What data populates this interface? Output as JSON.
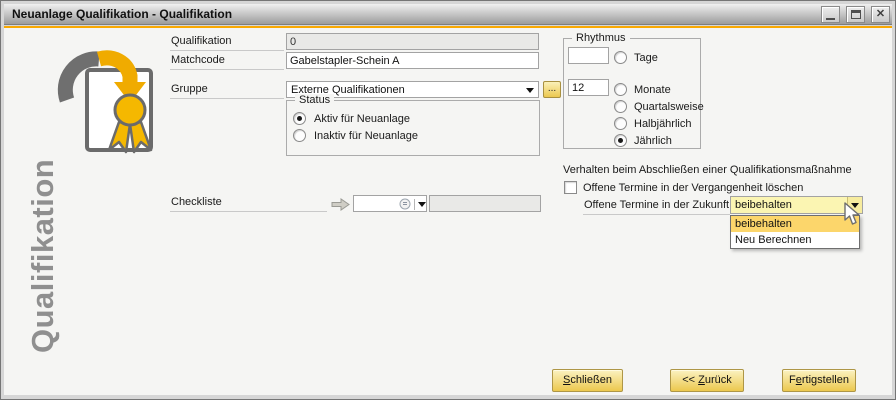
{
  "window": {
    "title": "Neuanlage Qualifikation - Qualifikation"
  },
  "sidebar": {
    "vertical_label": "Qualifikation",
    "icon": "certificate-icon"
  },
  "form": {
    "qualifikation_label": "Qualifikation",
    "qualifikation_value": "0",
    "matchcode_label": "Matchcode",
    "matchcode_value": "Gabelstapler-Schein A",
    "gruppe_label": "Gruppe",
    "gruppe_value": "Externe Qualifikationen",
    "browse_label": "...",
    "status": {
      "title": "Status",
      "aktiv_label": "Aktiv für Neuanlage",
      "inaktiv_label": "Inaktiv für Neuanlage",
      "selected": "Aktiv für Neuanlage"
    },
    "checkliste_label": "Checkliste",
    "checkliste_value": "",
    "checkliste_value2": ""
  },
  "rhythmus": {
    "title": "Rhythmus",
    "tage_value": "",
    "tage_label": "Tage",
    "monate_value": "12",
    "monate_label": "Monate",
    "quartalsweise_label": "Quartalsweise",
    "halbjaehrlich_label": "Halbjährlich",
    "jaehrlich_label": "Jährlich",
    "selected": "Jährlich"
  },
  "verhalten": {
    "heading": "Verhalten beim Abschließen einer Qualifikationsmaßnahme",
    "vergangenheit_label": "Offene Termine in der Vergangenheit löschen",
    "vergangenheit_checked": false,
    "zukunft_label": "Offene Termine in der Zukunft",
    "zukunft_value": "beibehalten",
    "options": [
      "beibehalten",
      "Neu Berechnen"
    ],
    "highlighted_option": "beibehalten"
  },
  "footer": {
    "schliessen": {
      "u": "S",
      "rest": "chließen"
    },
    "zurueck": {
      "pre": "<< ",
      "u": "Z",
      "rest": "urück"
    },
    "fertigstellen": {
      "pre": "F",
      "u": "e",
      "rest": "rtigstellen"
    }
  },
  "colors": {
    "accent": "#F9A800",
    "button_gold_top": "#FBF2C2",
    "button_gold_bottom": "#ECC84E",
    "combo_focus_bg": "#FBF5B2",
    "list_highlight": "#FCD66B",
    "title_text": "#111111"
  }
}
